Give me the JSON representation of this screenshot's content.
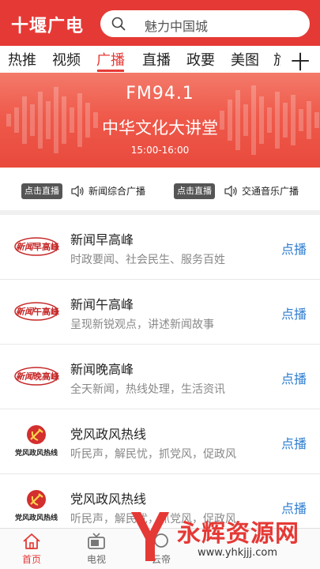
{
  "header": {
    "app_title": "十堰广电",
    "search_placeholder": "魅力中国城"
  },
  "tabs": [
    {
      "label": "热推",
      "active": false
    },
    {
      "label": "视频",
      "active": false
    },
    {
      "label": "广播",
      "active": true
    },
    {
      "label": "直播",
      "active": false
    },
    {
      "label": "政要",
      "active": false
    },
    {
      "label": "美图",
      "active": false
    },
    {
      "label": "旅",
      "active": false
    }
  ],
  "tabs_more": "十",
  "banner": {
    "frequency": "FM94.1",
    "program": "中华文化大讲堂",
    "time": "15:00-16:00"
  },
  "live_channels": [
    {
      "button": "点击直播",
      "name": "新闻综合广播"
    },
    {
      "button": "点击直播",
      "name": "交通音乐广播"
    }
  ],
  "programs": [
    {
      "logo": "xinwen-zao-logo",
      "logo_text": "早高峰",
      "title": "新闻早高峰",
      "desc": "时政要闻、社会民生、服务百姓",
      "action": "点播"
    },
    {
      "logo": "xinwen-wu-logo",
      "logo_text": "午高峰",
      "title": "新闻午高峰",
      "desc": "呈现新锐观点，讲述新闻故事",
      "action": "点播"
    },
    {
      "logo": "xinwen-wan-logo",
      "logo_text": "晚高峰",
      "title": "新闻晚高峰",
      "desc": "全天新闻，热线处理，生活资讯",
      "action": "点播"
    },
    {
      "logo": "dangfeng-logo",
      "logo_text": "党风政风热线",
      "title": "党风政风热线",
      "desc": "听民声，解民忧，抓党风，促政风",
      "action": "点播"
    },
    {
      "logo": "dangfeng-logo",
      "logo_text": "党风政风热线",
      "title": "党风政风热线",
      "desc": "听民声，解民忧，抓党风，促政风",
      "action": "点播"
    }
  ],
  "bottom_nav": [
    {
      "label": "首页",
      "icon": "home-icon",
      "active": true
    },
    {
      "label": "电视",
      "icon": "tv-icon",
      "active": false
    },
    {
      "label": "云帝",
      "icon": "cloud-icon",
      "active": false
    },
    {
      "label": "",
      "icon": "",
      "active": false
    },
    {
      "label": "",
      "icon": "",
      "active": false
    }
  ],
  "watermark": {
    "text": "永辉资源网",
    "url": "www.yhkjjj.com"
  },
  "colors": {
    "brand": "#e53935",
    "link": "#2e7dd1"
  }
}
